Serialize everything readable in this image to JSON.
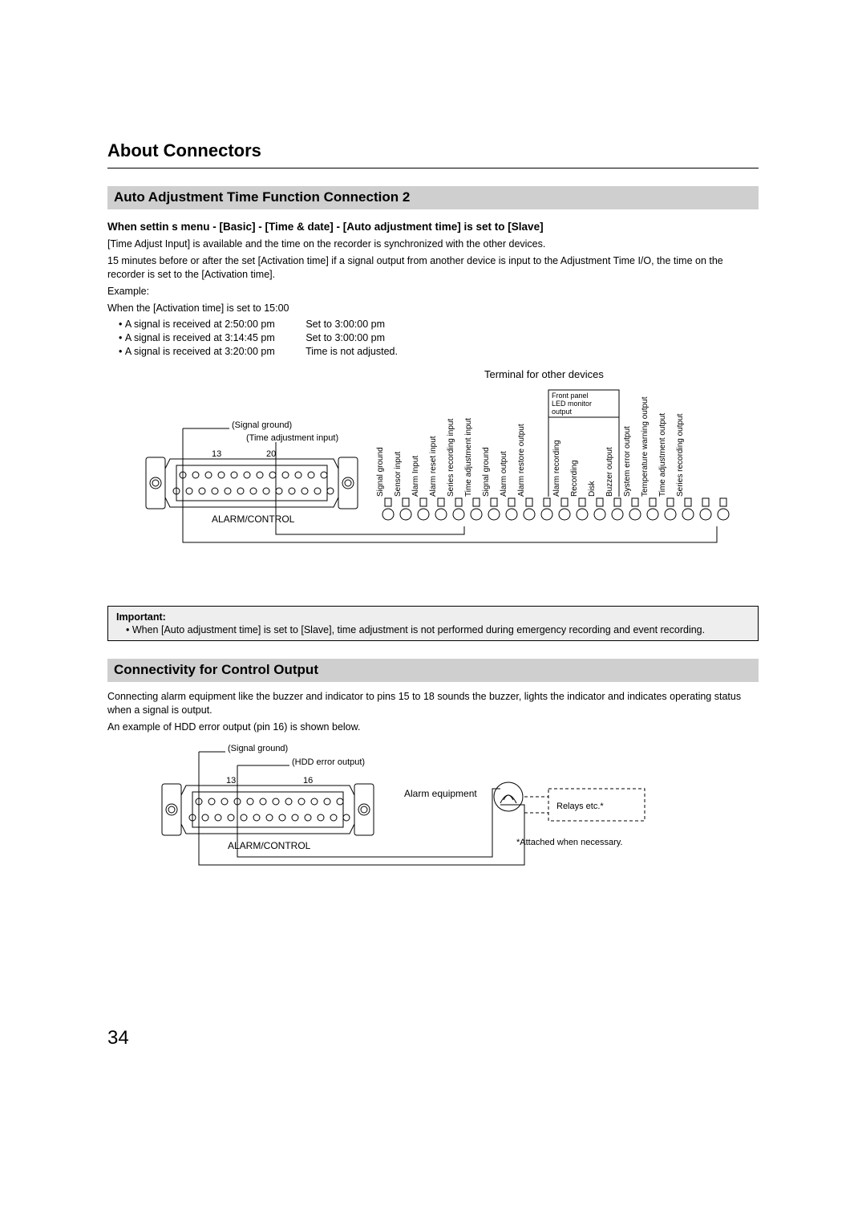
{
  "title": "About Connectors",
  "section1": {
    "heading": "Auto Adjustment Time Function Connection 2",
    "subheading": "When settin s menu - [Basic] - [Time & date] - [Auto adjustment time] is set to [Slave]",
    "p1": "[Time Adjust Input] is available and the time on the recorder is synchronized with the other devices.",
    "p2": "15 minutes before or after the set [Activation time] if a signal output from another device is input to the Adjustment Time I/O, the time on the recorder is set to the [Activation time].",
    "p3": "Example:",
    "p4": "When the [Activation time] is set to 15:00",
    "bullets": [
      {
        "a": "A signal is received at 2:50:00 pm",
        "b": "Set to 3:00:00 pm"
      },
      {
        "a": "A signal is received at 3:14:45 pm",
        "b": "Set to 3:00:00 pm"
      },
      {
        "a": "A signal is received at 3:20:00 pm",
        "b": "Time is not adjusted."
      }
    ],
    "diagram": {
      "terminal_title": "Terminal for other devices",
      "box_label": "Front panel LED monitor output",
      "signal_ground": "(Signal ground)",
      "time_adj_input": "(Time adjustment input)",
      "pin13": "13",
      "pin20": "20",
      "alarm_control": "ALARM/CONTROL",
      "pins": [
        "Signal ground",
        "Sensor input",
        "Alarm Input",
        "Alarm reset input",
        "Series recording input",
        "Time adjustment input",
        "Signal ground",
        "Alarm output",
        "Alarm restore output",
        "",
        "Alarm recording",
        "Recording",
        "Disk",
        "Buzzer output",
        "System error output",
        "Temperature warning output",
        "Time adjustment output",
        "Series recording output"
      ]
    },
    "important": {
      "title": "Important:",
      "text": "When [Auto adjustment time] is set to [Slave], time adjustment is not performed during emergency recording and event recording."
    }
  },
  "section2": {
    "heading": "Connectivity for Control Output",
    "p1": "Connecting alarm equipment like the buzzer and indicator to pins 15 to 18 sounds the buzzer, lights the indicator and indicates operating status when a signal is output.",
    "p2": "An example of HDD error output (pin 16) is shown below.",
    "diagram": {
      "signal_ground": "(Signal ground)",
      "hdd_error": "(HDD error output)",
      "pin13": "13",
      "pin16": "16",
      "alarm_control": "ALARM/CONTROL",
      "alarm_equipment": "Alarm equipment",
      "relays": "Relays etc.*",
      "footnote": "*Attached when necessary."
    }
  },
  "page_number": "34"
}
